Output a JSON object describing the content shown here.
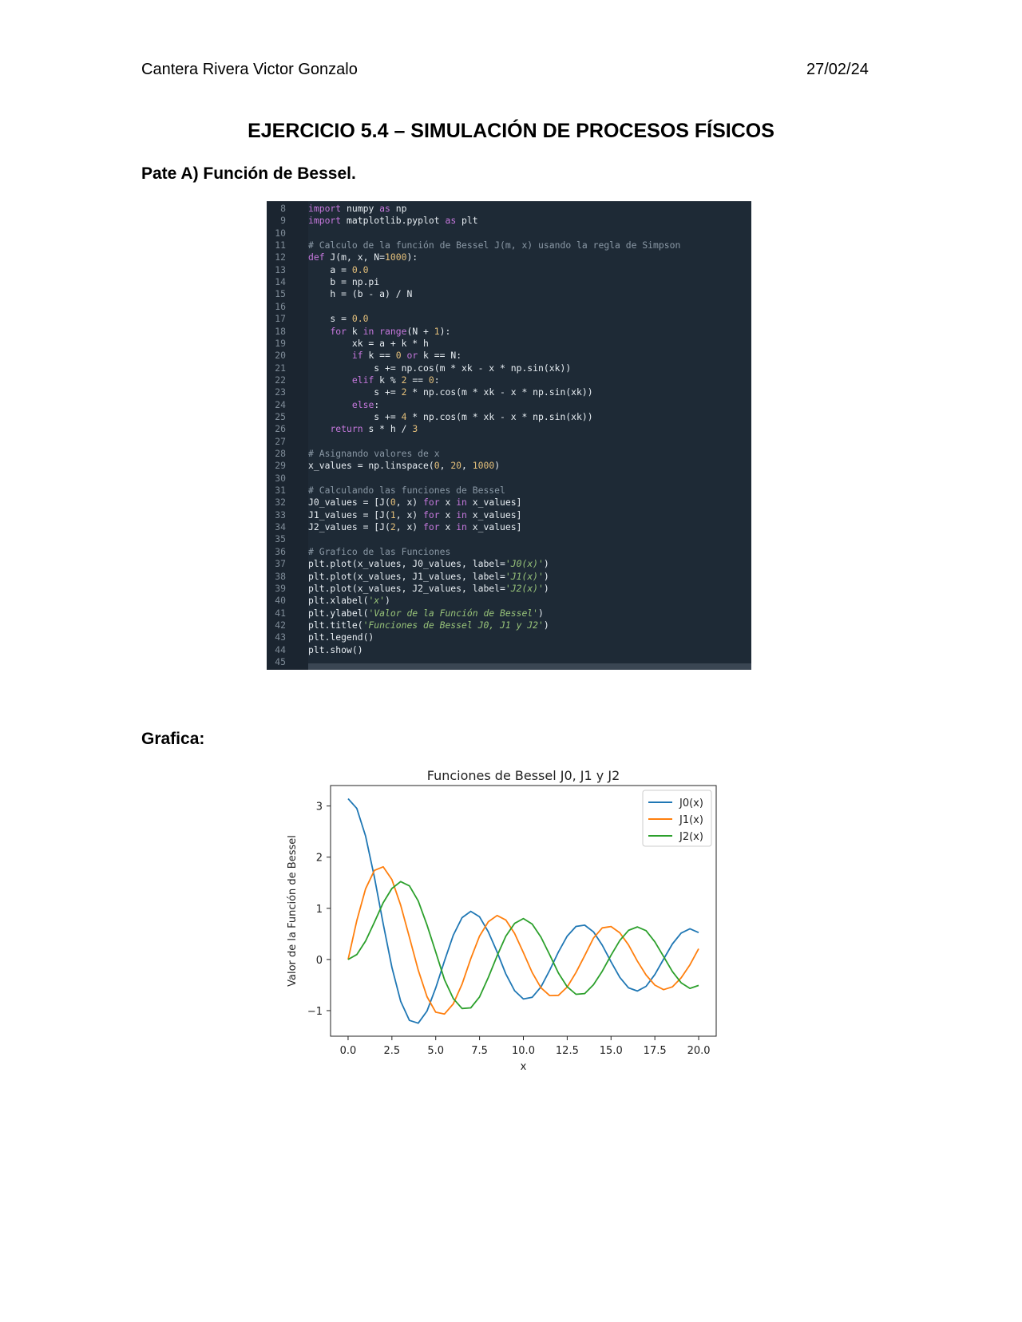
{
  "header": {
    "author": "Cantera Rivera Victor Gonzalo",
    "date": "27/02/24"
  },
  "title": "EJERCICIO 5.4 – SIMULACIÓN DE PROCESOS FÍSICOS",
  "section_a": "Pate A) Función de Bessel.",
  "section_b": "Grafica:",
  "code": {
    "lines": [
      {
        "n": "8",
        "t": "import numpy as np"
      },
      {
        "n": "9",
        "t": "import matplotlib.pyplot as plt"
      },
      {
        "n": "10",
        "t": ""
      },
      {
        "n": "11",
        "t": "# Calculo de la función de Bessel J(m, x) usando la regla de Simpson"
      },
      {
        "n": "12",
        "t": "def J(m, x, N=1000):"
      },
      {
        "n": "13",
        "t": "    a = 0.0"
      },
      {
        "n": "14",
        "t": "    b = np.pi"
      },
      {
        "n": "15",
        "t": "    h = (b - a) / N"
      },
      {
        "n": "16",
        "t": ""
      },
      {
        "n": "17",
        "t": "    s = 0.0"
      },
      {
        "n": "18",
        "t": "    for k in range(N + 1):"
      },
      {
        "n": "19",
        "t": "        xk = a + k * h"
      },
      {
        "n": "20",
        "t": "        if k == 0 or k == N:"
      },
      {
        "n": "21",
        "t": "            s += np.cos(m * xk - x * np.sin(xk))"
      },
      {
        "n": "22",
        "t": "        elif k % 2 == 0:"
      },
      {
        "n": "23",
        "t": "            s += 2 * np.cos(m * xk - x * np.sin(xk))"
      },
      {
        "n": "24",
        "t": "        else:"
      },
      {
        "n": "25",
        "t": "            s += 4 * np.cos(m * xk - x * np.sin(xk))"
      },
      {
        "n": "26",
        "t": "    return s * h / 3"
      },
      {
        "n": "27",
        "t": ""
      },
      {
        "n": "28",
        "t": "# Asignando valores de x"
      },
      {
        "n": "29",
        "t": "x_values = np.linspace(0, 20, 1000)"
      },
      {
        "n": "30",
        "t": ""
      },
      {
        "n": "31",
        "t": "# Calculando las funciones de Bessel"
      },
      {
        "n": "32",
        "t": "J0_values = [J(0, x) for x in x_values]"
      },
      {
        "n": "33",
        "t": "J1_values = [J(1, x) for x in x_values]"
      },
      {
        "n": "34",
        "t": "J2_values = [J(2, x) for x in x_values]"
      },
      {
        "n": "35",
        "t": ""
      },
      {
        "n": "36",
        "t": "# Grafico de las Funciones"
      },
      {
        "n": "37",
        "t": "plt.plot(x_values, J0_values, label='J0(x)')"
      },
      {
        "n": "38",
        "t": "plt.plot(x_values, J1_values, label='J1(x)')"
      },
      {
        "n": "39",
        "t": "plt.plot(x_values, J2_values, label='J2(x)')"
      },
      {
        "n": "40",
        "t": "plt.xlabel('x')"
      },
      {
        "n": "41",
        "t": "plt.ylabel('Valor de la Función de Bessel')"
      },
      {
        "n": "42",
        "t": "plt.title('Funciones de Bessel J0, J1 y J2')"
      },
      {
        "n": "43",
        "t": "plt.legend()"
      },
      {
        "n": "44",
        "t": "plt.show()"
      },
      {
        "n": "45",
        "t": ""
      }
    ]
  },
  "chart_data": {
    "type": "line",
    "title": "Funciones de Bessel J0, J1 y J2",
    "xlabel": "x",
    "ylabel": "Valor de la Función de Bessel",
    "xlim": [
      -1,
      21
    ],
    "ylim": [
      -1.5,
      3.4
    ],
    "xticks": [
      "0.0",
      "2.5",
      "5.0",
      "7.5",
      "10.0",
      "12.5",
      "15.0",
      "17.5",
      "20.0"
    ],
    "yticks": [
      "3",
      "2",
      "1",
      "0",
      "−1"
    ],
    "legend_position": "top-right",
    "x": [
      0,
      0.5,
      1,
      1.5,
      2,
      2.5,
      3,
      3.5,
      4,
      4.5,
      5,
      5.5,
      6,
      6.5,
      7,
      7.5,
      8,
      8.5,
      9,
      9.5,
      10,
      10.5,
      11,
      11.5,
      12,
      12.5,
      13,
      13.5,
      14,
      14.5,
      15,
      15.5,
      16,
      16.5,
      17,
      17.5,
      18,
      18.5,
      19,
      19.5,
      20
    ],
    "series": [
      {
        "name": "J0(x)",
        "color": "#1f77b4",
        "values": [
          3.142,
          2.952,
          2.41,
          1.61,
          0.701,
          -0.151,
          -0.817,
          -1.191,
          -1.245,
          -1.008,
          -0.558,
          -0.027,
          0.474,
          0.817,
          0.941,
          0.835,
          0.54,
          0.146,
          -0.283,
          -0.61,
          -0.773,
          -0.74,
          -0.537,
          -0.212,
          0.147,
          0.457,
          0.646,
          0.671,
          0.539,
          0.279,
          -0.045,
          -0.35,
          -0.555,
          -0.617,
          -0.524,
          -0.294,
          0.006,
          0.303,
          0.516,
          0.601,
          0.526
        ]
      },
      {
        "name": "J1(x)",
        "color": "#ff7f0e",
        "values": [
          0,
          0.761,
          1.382,
          1.741,
          1.812,
          1.564,
          1.063,
          0.432,
          -0.208,
          -0.727,
          -1.031,
          -1.066,
          -0.868,
          -0.483,
          0.015,
          0.457,
          0.737,
          0.859,
          0.772,
          0.51,
          0.136,
          -0.254,
          -0.553,
          -0.706,
          -0.701,
          -0.538,
          -0.254,
          0.075,
          0.418,
          0.617,
          0.644,
          0.521,
          0.283,
          -0.03,
          -0.305,
          -0.502,
          -0.59,
          -0.536,
          -0.36,
          -0.105,
          0.21
        ]
      },
      {
        "name": "J2(x)",
        "color": "#2ca02c",
        "values": [
          0,
          0.096,
          0.361,
          0.728,
          1.107,
          1.387,
          1.523,
          1.438,
          1.143,
          0.674,
          0.146,
          -0.395,
          -0.763,
          -0.958,
          -0.946,
          -0.733,
          -0.352,
          0.072,
          0.455,
          0.705,
          0.8,
          0.692,
          0.437,
          0.093,
          -0.266,
          -0.534,
          -0.68,
          -0.667,
          -0.494,
          -0.23,
          0.082,
          0.371,
          0.57,
          0.637,
          0.563,
          0.345,
          0.057,
          -0.234,
          -0.456,
          -0.566,
          -0.508
        ]
      }
    ]
  }
}
